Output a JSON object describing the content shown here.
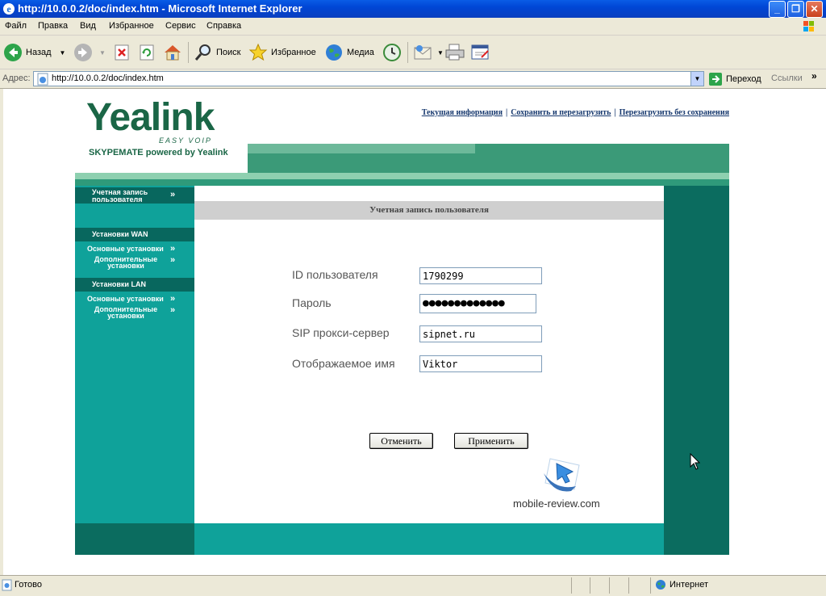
{
  "window": {
    "title": "http://10.0.0.2/doc/index.htm - Microsoft Internet Explorer",
    "minimize": "_",
    "maximize": "❐",
    "close": "✕"
  },
  "menu": [
    "Файл",
    "Правка",
    "Вид",
    "Избранное",
    "Сервис",
    "Справка"
  ],
  "toolbar": {
    "back": "Назад",
    "search": "Поиск",
    "favorites": "Избранное",
    "media": "Медиа"
  },
  "address": {
    "label": "Адрес:",
    "url": "http://10.0.0.2/doc/index.htm",
    "go": "Переход",
    "links": "Ссылки"
  },
  "page": {
    "logo": {
      "brand": "Yealink",
      "sub": "EASY VOIP",
      "tagline": "SKYPEMATE powered by Yealink"
    },
    "top_links": [
      "Текущая информация",
      "Сохранить и перезагрузить",
      "Перезагрузить без сохранения"
    ],
    "sidebar": {
      "user_account": "Учетная запись пользователя",
      "wan_header": "Установки WAN",
      "wan_items": [
        "Основные установки",
        "Дополнительные установки"
      ],
      "lan_header": "Установки LAN",
      "lan_items": [
        "Основные установки",
        "Дополнительные установки"
      ]
    },
    "section_title": "Учетная запись пользователя",
    "form": {
      "user_id_label": "ID пользователя",
      "user_id_value": "1790299",
      "password_label": "Пароль",
      "password_value": "●●●●●●●●●●●●●",
      "sip_proxy_label": "SIP прокси-сервер",
      "sip_proxy_value": "sipnet.ru",
      "display_name_label": "Отображаемое имя",
      "display_name_value": "Viktor"
    },
    "buttons": {
      "cancel": "Отменить",
      "apply": "Применить"
    },
    "watermark": "mobile-review.com"
  },
  "status": {
    "text": "Готово",
    "zone": "Интернет"
  },
  "colors": {
    "brand_green": "#1a6646",
    "teal": "#0fa29a",
    "dark_teal": "#0b6c5f",
    "xp_blue": "#0046d5"
  }
}
